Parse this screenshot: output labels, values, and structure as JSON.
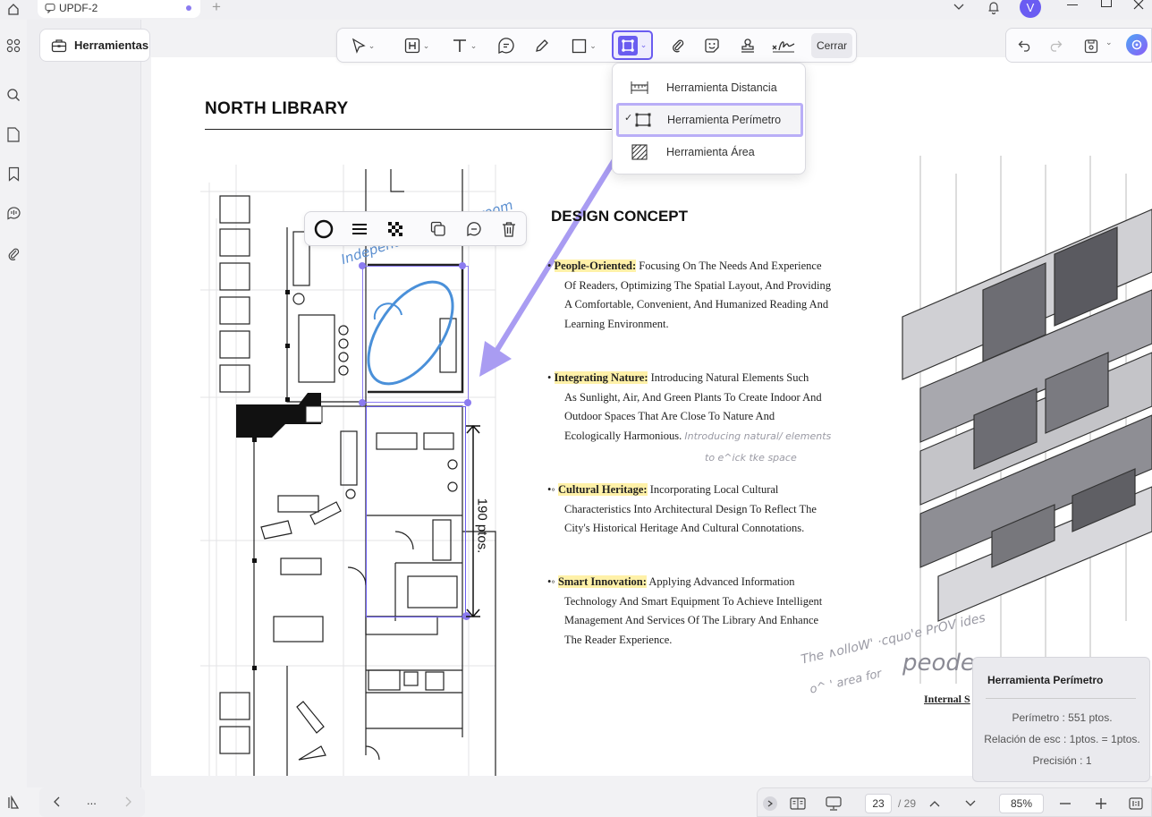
{
  "titlebar": {
    "tab_label": "UPDF-2",
    "new_tab": "+",
    "avatar_letter": "V"
  },
  "sidebar_panel": {
    "tools_label": "Herramientas"
  },
  "toolbar": {
    "close_label": "Cerrar"
  },
  "measure_dropdown": {
    "items": [
      {
        "label": "Herramienta Distancia",
        "icon": "ruler-icon",
        "selected": false
      },
      {
        "label": "Herramienta Perímetro",
        "icon": "perimeter-icon",
        "selected": true
      },
      {
        "label": "Herramienta Área",
        "icon": "area-icon",
        "selected": false
      }
    ],
    "check": "✓"
  },
  "document": {
    "title": "NORTH LIBRARY",
    "section_title": "DESIGN CONCEPT",
    "bullets": [
      {
        "marker": "•",
        "heading": "People-Oriented:",
        "lines": [
          "Focusing On The       Needs And Experience",
          "Of Readers, Optimizing The Spatial Layout, And Providing",
          "A Comfortable, Convenient, And Humanized Reading And",
          "Learning Environment."
        ]
      },
      {
        "marker": "•",
        "heading": "Integrating Nature:",
        "lines": [
          "Introducing Natural Elements Such",
          "As Sunlight, Air, And Green Plants To Create Indoor And",
          "Outdoor Spaces That Are Close To Nature And",
          "Ecologically Harmonious."
        ]
      },
      {
        "marker": "•◦",
        "heading": "Cultural Heritage:",
        "lines": [
          "Incorporating Local Cultural",
          "Characteristics Into Architectural Design To Reflect The",
          "City's Historical Heritage And Cultural Connotations."
        ]
      },
      {
        "marker": "•◦",
        "heading": "Smart Innovation:",
        "lines": [
          "Applying Advanced Information",
          "Technology And Smart Equipment To Achieve Intelligent",
          "Management And Services Of The Library And Enhance",
          "The Reader Experience."
        ]
      }
    ],
    "handwritten_nature": "Introducing natural/ elements",
    "handwritten_nature2": "to e^ick tke space",
    "handwritten_room": "Independent reading room",
    "handwritten_follow": "The ∧olloW' ·cquo'e PrOV ides",
    "handwritten_follow2": "o^   ' area for",
    "handwritten_people": "peode",
    "measure_label": "190 ptos.",
    "internal_label": "Internal S"
  },
  "info_panel": {
    "title": "Herramienta Perímetro",
    "perimeter": "Perímetro : 551 ptos.",
    "scale": "Relación de esc : 1ptos. = 1ptos.",
    "precision": "Precisión : 1"
  },
  "pager": {
    "current_page": "23",
    "total": "/ 29",
    "zoom": "85%",
    "more": "..."
  },
  "colors": {
    "accent": "#7b6cf0",
    "highlight": "#fff1a8",
    "annotation_blue": "#4a90d9"
  }
}
